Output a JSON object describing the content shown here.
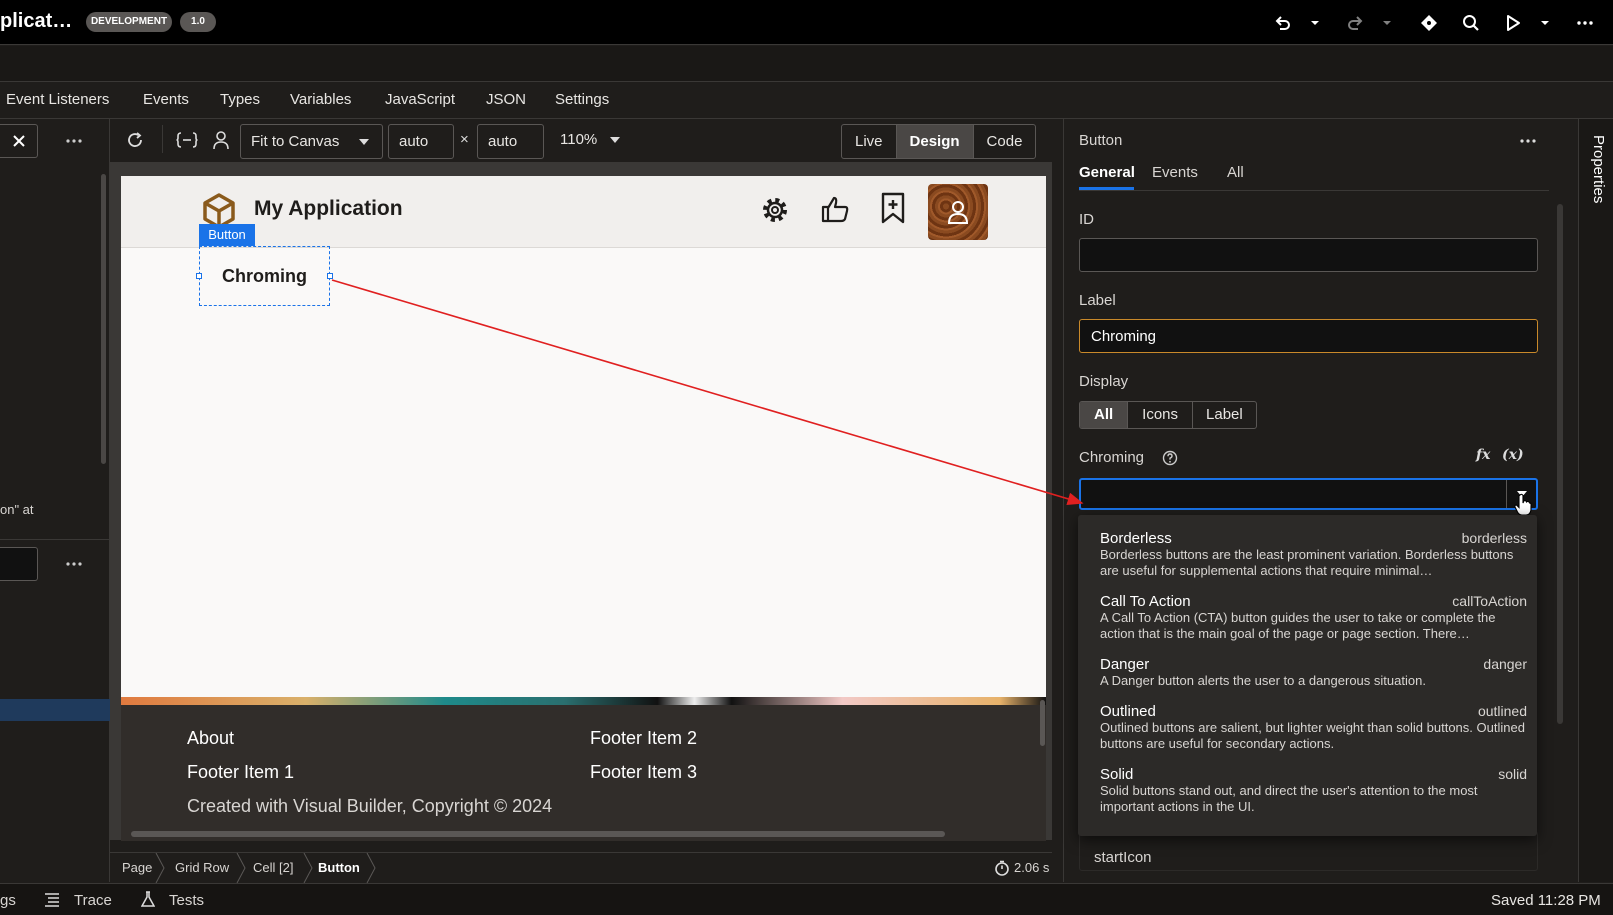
{
  "topbar": {
    "app_title": "plicat…",
    "badge_env": "DEVELOPMENT",
    "badge_version": "1.0"
  },
  "tabs": [
    "Event Listeners",
    "Events",
    "Types",
    "Variables",
    "JavaScript",
    "JSON",
    "Settings"
  ],
  "left_panel": {
    "snippet_text": "on\" at"
  },
  "canvas_toolbar": {
    "fit_label": "Fit to Canvas",
    "width_value": "auto",
    "times_sign": "×",
    "height_value": "auto",
    "zoom": "110%",
    "modes": [
      "Live",
      "Design",
      "Code"
    ],
    "active_mode": "Design"
  },
  "page": {
    "app_name": "My Application",
    "selection_tag": "Button",
    "button_label": "Chroming",
    "footer": {
      "col1": [
        "About",
        "Footer Item 1"
      ],
      "col2": [
        "Footer Item 2",
        "Footer Item 3"
      ],
      "copyright": "Created with Visual Builder, Copyright © 2024"
    }
  },
  "breadcrumb": [
    "Page",
    "Grid Row",
    "Cell [2]",
    "Button"
  ],
  "timer": "2.06 s",
  "statusbar": {
    "left_cut": "gs",
    "trace": "Trace",
    "tests": "Tests",
    "saved": "Saved 11:28 PM"
  },
  "properties": {
    "component": "Button",
    "tabs": [
      "General",
      "Events",
      "All"
    ],
    "active_tab": "General",
    "rail_label": "Properties",
    "id_label": "ID",
    "id_value": "",
    "label_label": "Label",
    "label_value": "Chroming",
    "display_label": "Display",
    "display_options": [
      "All",
      "Icons",
      "Label"
    ],
    "display_active": "All",
    "chroming_label": "Chroming",
    "chroming_value": "",
    "fx": "fx",
    "var": "(x)",
    "start_icon_label": "startIcon"
  },
  "chroming_options": [
    {
      "title": "Borderless",
      "value": "borderless",
      "desc": "Borderless buttons are the least prominent variation. Borderless buttons are useful for supplemental actions that require minimal…"
    },
    {
      "title": "Call To Action",
      "value": "callToAction",
      "desc": "A Call To Action (CTA) button guides the user to take or complete the action that is the main goal of the page or page section. There…"
    },
    {
      "title": "Danger",
      "value": "danger",
      "desc": "A Danger button alerts the user to a dangerous situation."
    },
    {
      "title": "Outlined",
      "value": "outlined",
      "desc": "Outlined buttons are salient, but lighter weight than solid buttons. Outlined buttons are useful for secondary actions."
    },
    {
      "title": "Solid",
      "value": "solid",
      "desc": "Solid buttons stand out, and direct the user's attention to the most important actions in the UI."
    }
  ],
  "colors": {
    "accent_blue": "#1a73e8",
    "focus_orange": "#c9892a",
    "arrow_red": "#e02020",
    "logo_brown": "#8a5a1c"
  }
}
